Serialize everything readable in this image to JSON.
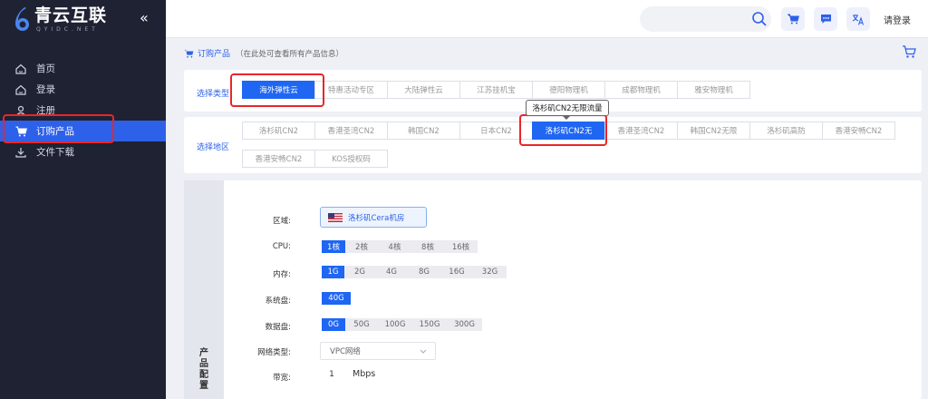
{
  "brand": {
    "name": "青云互联",
    "sub": "QYIDC.NET"
  },
  "sidebar": {
    "collapse_glyph": "«",
    "items": [
      {
        "label": "首页",
        "icon": "home-icon"
      },
      {
        "label": "登录",
        "icon": "login-icon"
      },
      {
        "label": "注册",
        "icon": "user-icon"
      },
      {
        "label": "订购产品",
        "icon": "cart-icon"
      },
      {
        "label": "文件下载",
        "icon": "download-icon"
      }
    ],
    "active_index": 3
  },
  "topbar": {
    "search_placeholder": "",
    "login_label": "请登录",
    "icons": [
      "search-icon",
      "cart-icon",
      "chat-icon",
      "translate-icon"
    ]
  },
  "breadcrumb": {
    "title": "订购产品",
    "note": "（在此处可查看所有产品信息）"
  },
  "type_section": {
    "label": "选择类型",
    "options": [
      "海外弹性云",
      "特惠活动专区",
      "大陆弹性云",
      "江苏挂机宝",
      "德阳物理机",
      "成都物理机",
      "雅安物理机"
    ],
    "selected": "海外弹性云"
  },
  "region_section": {
    "label": "选择地区",
    "row1": [
      "洛杉矶CN2",
      "香港圣湾CN2",
      "韩国CN2",
      "日本CN2",
      "洛杉矶CN2无",
      "香港圣湾CN2",
      "韩国CN2无限",
      "洛杉矶高防",
      "香港安畅CN2"
    ],
    "row2": [
      "香港安畅CN2",
      "KOS授权码"
    ],
    "selected": "洛杉矶CN2无",
    "tooltip": "洛杉矶CN2无限流量"
  },
  "config": {
    "side_title": "产品配置",
    "region": {
      "label": "区域:",
      "value": "洛杉矶Cera机房"
    },
    "cpu": {
      "label": "CPU:",
      "options": [
        "1核",
        "2核",
        "4核",
        "8核",
        "16核"
      ],
      "selected": "1核"
    },
    "memory": {
      "label": "内存:",
      "options": [
        "1G",
        "2G",
        "4G",
        "8G",
        "16G",
        "32G"
      ],
      "selected": "1G"
    },
    "system_disk": {
      "label": "系统盘:",
      "options": [
        "40G"
      ],
      "selected": "40G"
    },
    "data_disk": {
      "label": "数据盘:",
      "options": [
        "0G",
        "50G",
        "100G",
        "150G",
        "300G"
      ],
      "selected": "0G"
    },
    "network": {
      "label": "网络类型:",
      "value": "VPC网络"
    },
    "bandwidth": {
      "label": "带宽:",
      "value": "1",
      "unit": "Mbps"
    }
  },
  "colors": {
    "sidebar_bg": "#1f2233",
    "accent": "#1f66f3",
    "highlight_box": "#e8262a"
  }
}
